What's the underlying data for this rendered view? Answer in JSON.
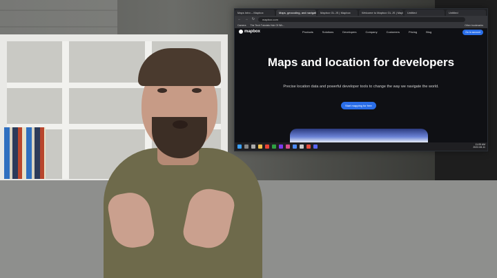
{
  "browser": {
    "tabs": [
      {
        "label": "Maps Intro – Mapbox"
      },
      {
        "label": "Maps, geocoding, and navigation",
        "active": true
      },
      {
        "label": "Mapbox GL JS | Mapbox"
      },
      {
        "label": "Welcome to Mapbox GL JS | Mapbox"
      },
      {
        "label": "Untitled"
      },
      {
        "label": "Untitled"
      }
    ],
    "url": "mapbox.com",
    "bookmarks": [
      "Camera",
      "The Tech Tutorials Hub Of Wh..."
    ],
    "other_bookmarks": "Other bookmarks"
  },
  "site": {
    "logo": "mapbox",
    "menu": [
      "Products",
      "Solutions",
      "Developers",
      "Company",
      "Customers",
      "Pricing",
      "Blog"
    ],
    "signup": "Go to account",
    "hero_title": "Maps and location for developers",
    "hero_sub": "Precise location data and powerful developer tools to change the way we navigate the world.",
    "cta": "Start mapping for free"
  },
  "taskbar": {
    "time": "11:05 AM",
    "date": "2022-08-11"
  },
  "colors": {
    "accent": "#2a6ee8",
    "site_bg": "#0f1014"
  }
}
